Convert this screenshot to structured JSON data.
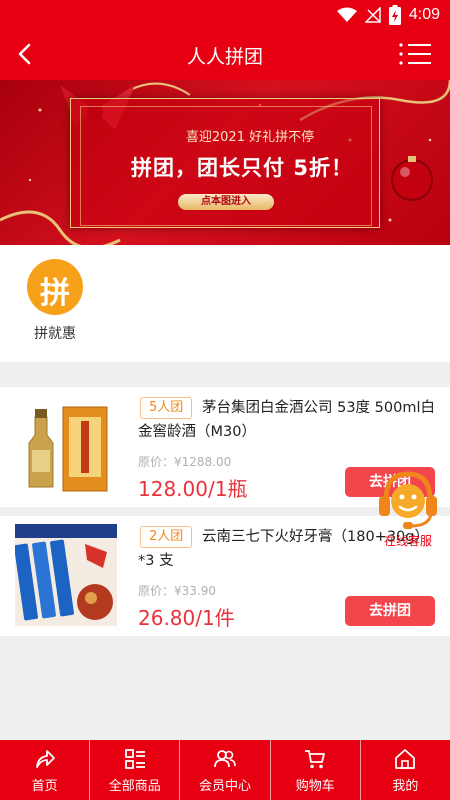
{
  "status_bar": {
    "time": "4:09"
  },
  "header": {
    "title": "人人拼团"
  },
  "banner": {
    "welcome": "喜迎2021   好礼拼不停",
    "headline": "拼团，团长只付 5折！",
    "enter_button": "点本图进入"
  },
  "quick_entry": {
    "icon_glyph": "拼",
    "label": "拼就惠"
  },
  "products": [
    {
      "badge": "5人团",
      "name": "茅台集团白金酒公司 53度 500ml白金窖龄酒（M30）",
      "original_price": "原价：¥1288.00",
      "price": "128.00/1瓶",
      "button": "去拼团"
    },
    {
      "badge": "2人团",
      "name": "云南三七下火好牙膏（180+30g）*3 支",
      "original_price": "原价：¥33.90",
      "price": "26.80/1件",
      "button": "去拼团"
    }
  ],
  "customer_service": {
    "label": "在线客服"
  },
  "tabbar": [
    {
      "label": "首页",
      "icon": "share-arrow-icon"
    },
    {
      "label": "全部商品",
      "icon": "grid-list-icon"
    },
    {
      "label": "会员中心",
      "icon": "users-icon"
    },
    {
      "label": "购物车",
      "icon": "cart-icon"
    },
    {
      "label": "我的",
      "icon": "home-icon"
    }
  ],
  "colors": {
    "brand_red": "#e60012",
    "price_red": "#e8323a",
    "badge_orange": "#f28a1e",
    "button_red": "#f2454c"
  }
}
